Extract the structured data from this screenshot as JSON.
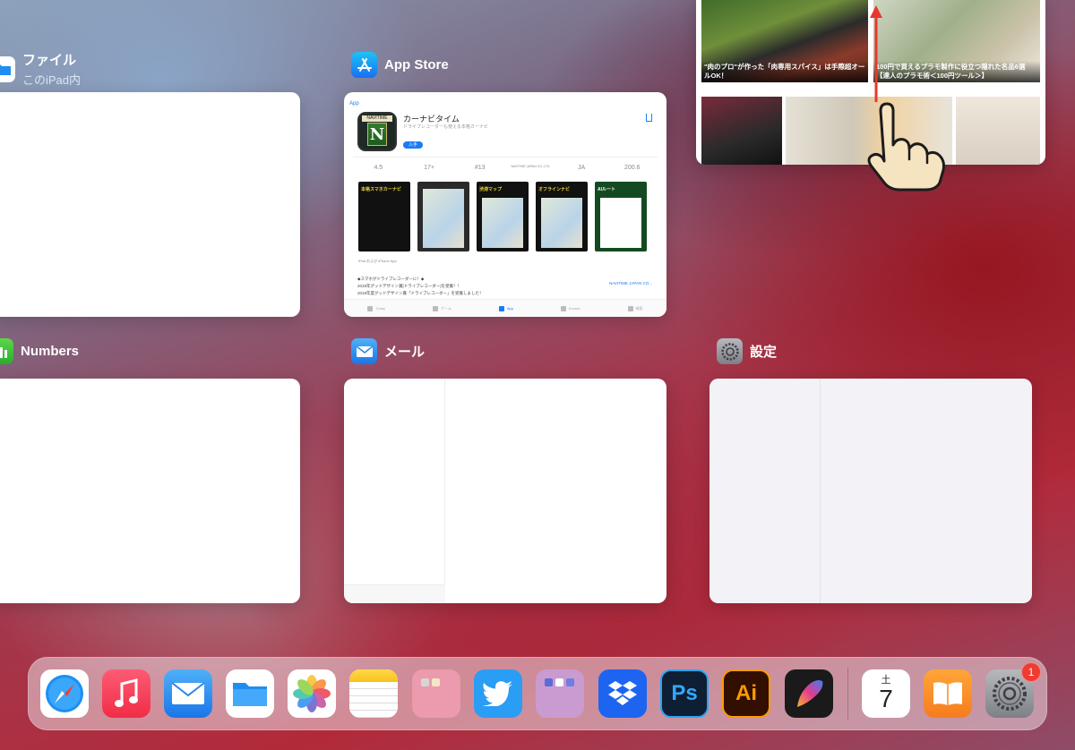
{
  "apps": {
    "files": {
      "name": "ファイル",
      "subtitle": "このiPad内"
    },
    "appstore": {
      "name": "App Store",
      "back_label": "App",
      "app_name": "カーナビタイム",
      "app_subtitle": "ドライブレコーダーも使える本格カーナビ",
      "get_label": "入手",
      "icon_banner": "NAVITIME",
      "stats": [
        {
          "value": "4.5"
        },
        {
          "value": "17+"
        },
        {
          "value": "#13"
        },
        {
          "value": "NAVITIME JAPAN CO.,LTD."
        },
        {
          "value": "JA"
        },
        {
          "value": "200.6"
        }
      ],
      "screens": [
        {
          "caption": "本格スマホカーナビ"
        },
        {
          "caption": ""
        },
        {
          "caption": "渋滞マップ"
        },
        {
          "caption": "オフラインナビ"
        },
        {
          "caption": "AIルート"
        }
      ],
      "device_label": "iPad および iPhone App",
      "desc_lines": [
        "◆スマホがドライブレコーダーに！◆",
        "2019年グッドデザイン賞[ドライブレコーダー]を受賞！！",
        "2019年度グッドデザイン賞「ドライブレコーダー」を受賞しました！"
      ],
      "developer": "NAVITIME JAPAN CO...",
      "tabs": [
        "Today",
        "ゲーム",
        "App",
        "Arcade",
        "検索"
      ]
    },
    "numbers": {
      "name": "Numbers"
    },
    "mail": {
      "name": "メール"
    },
    "settings": {
      "name": "設定"
    },
    "browser": {
      "captions": [
        "\"肉のプロ\"が作った「肉専用スパイス」は手際超オールOK！",
        "100円で買えるプラモ製作に役立つ隠れた名品6選【達人のプラモ術＜100円ツール＞】"
      ]
    }
  },
  "dock": {
    "calendar_weekday": "土",
    "calendar_day": "7",
    "settings_badge": "1"
  },
  "colors": {
    "accent": "#1a7cf5",
    "badge": "#ef3b30",
    "swipe_arrow": "#e8372c"
  }
}
